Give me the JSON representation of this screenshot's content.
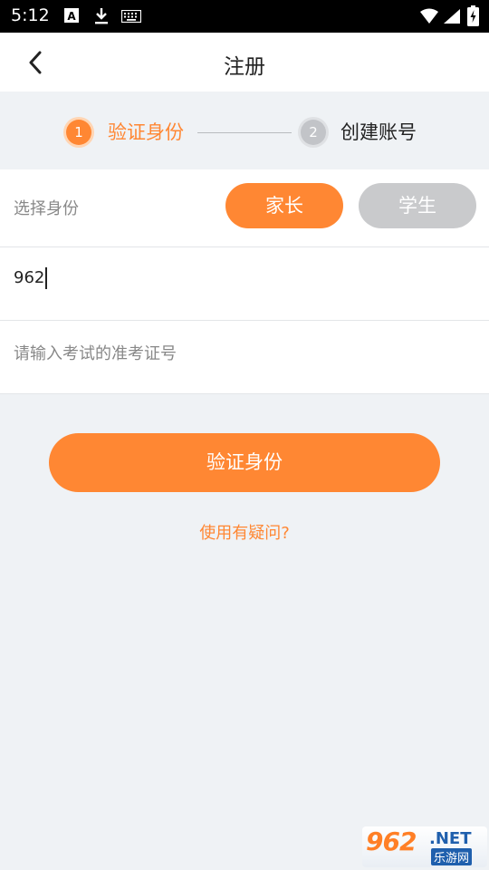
{
  "status_bar": {
    "time": "5:12",
    "left_icons": [
      "text-a-icon",
      "download-icon",
      "keyboard-icon"
    ],
    "right_icons": [
      "wifi-icon",
      "signal-icon",
      "battery-charging-icon"
    ]
  },
  "app_bar": {
    "title": "注册",
    "back_icon": "back-chevron-icon"
  },
  "steps": {
    "items": [
      {
        "number": "1",
        "label": "验证身份",
        "state": "active"
      },
      {
        "number": "2",
        "label": "创建账号",
        "state": "inactive"
      }
    ]
  },
  "form": {
    "role": {
      "label": "选择身份",
      "options": [
        {
          "label": "家长",
          "selected": true
        },
        {
          "label": "学生",
          "selected": false
        }
      ]
    },
    "input1": {
      "value": "962",
      "placeholder": ""
    },
    "input2": {
      "value": "",
      "placeholder": "请输入考试的准考证号"
    }
  },
  "actions": {
    "verify_button": "验证身份",
    "help_link": "使用有疑问?"
  },
  "watermark": {
    "brand": "962",
    "domain": ".NET",
    "subtitle": "乐游网"
  },
  "colors": {
    "accent": "#ff8733",
    "inactive_button": "#c9cacc",
    "background": "#eff2f5",
    "text": "#222222",
    "placeholder": "#888888"
  }
}
